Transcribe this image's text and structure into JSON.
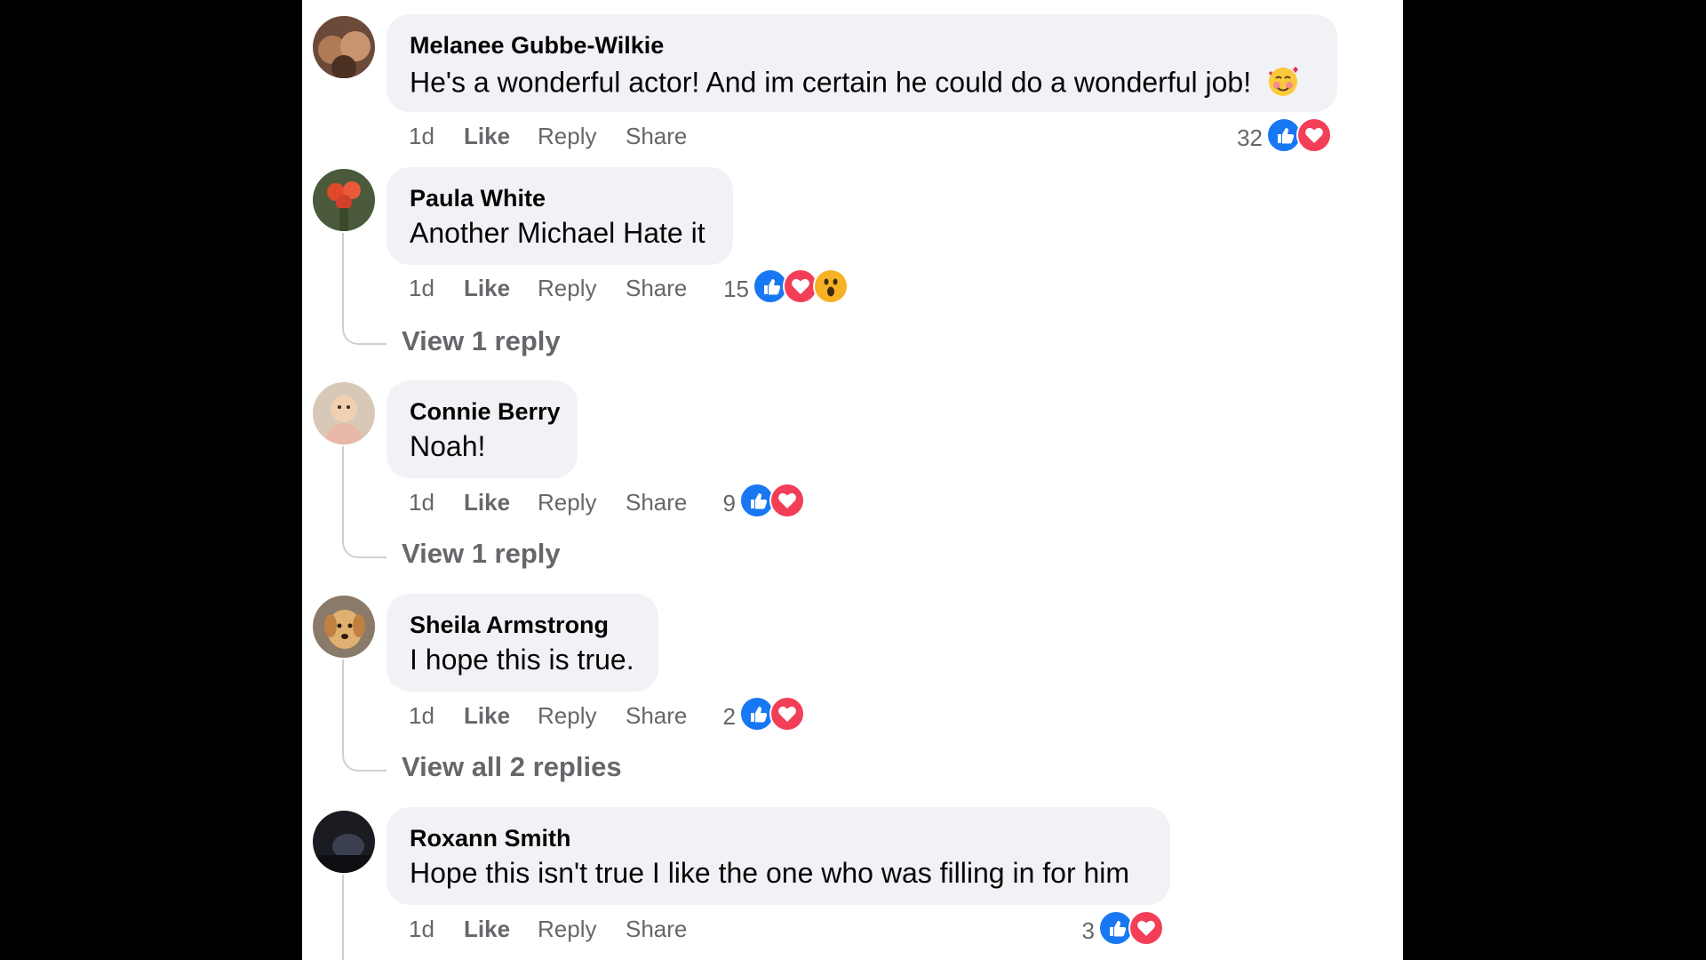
{
  "comments": [
    {
      "author": "Melanee Gubbe-Wilkie",
      "text": "He's a wonderful actor! And im certain he could do a wonderful job!",
      "text_emoji": "smiling-face-with-hearts-emoji",
      "time": "1d",
      "like": "Like",
      "reply": "Reply",
      "share": "Share",
      "reaction_count": "32",
      "reactions": [
        "like-reaction-icon",
        "love-reaction-icon"
      ]
    },
    {
      "author": "Paula White",
      "text": "Another Michael Hate it",
      "time": "1d",
      "like": "Like",
      "reply": "Reply",
      "share": "Share",
      "reaction_count": "15",
      "reactions": [
        "like-reaction-icon",
        "love-reaction-icon",
        "wow-reaction-icon"
      ],
      "view_replies": "View 1 reply"
    },
    {
      "author": "Connie Berry",
      "text": "Noah!",
      "time": "1d",
      "like": "Like",
      "reply": "Reply",
      "share": "Share",
      "reaction_count": "9",
      "reactions": [
        "like-reaction-icon",
        "love-reaction-icon"
      ],
      "view_replies": "View 1 reply"
    },
    {
      "author": "Sheila Armstrong",
      "text": "I hope this is true.",
      "time": "1d",
      "like": "Like",
      "reply": "Reply",
      "share": "Share",
      "reaction_count": "2",
      "reactions": [
        "like-reaction-icon",
        "love-reaction-icon"
      ],
      "view_replies": "View all 2 replies"
    },
    {
      "author": "Roxann Smith",
      "text": "Hope this isn't true I like the one who was filling in for him",
      "time": "1d",
      "like": "Like",
      "reply": "Reply",
      "share": "Share",
      "reaction_count": "3",
      "reactions": [
        "like-reaction-icon",
        "love-reaction-icon"
      ]
    }
  ],
  "colors": {
    "like": "#1877f2",
    "love": "#f33e58",
    "wow": "#f7b125",
    "bubble": "#f0f2f5",
    "secondary_text": "#65676b"
  }
}
